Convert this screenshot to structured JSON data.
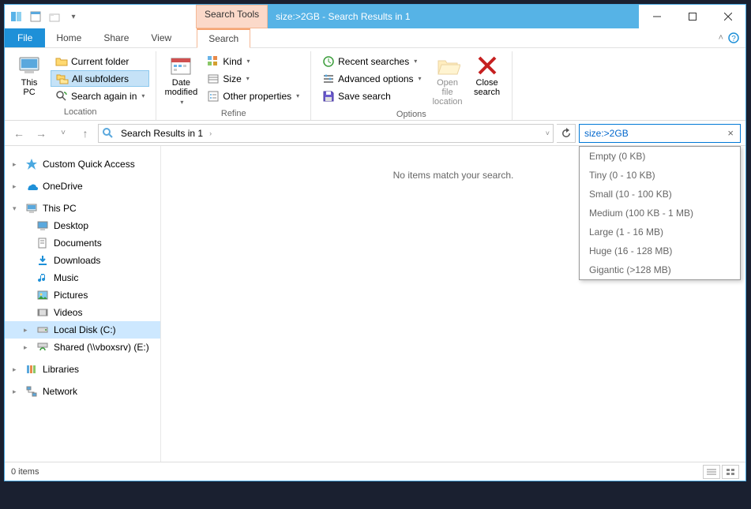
{
  "window": {
    "context_tab": "Search Tools",
    "title": "size:>2GB - Search Results in 1"
  },
  "menubar": {
    "file": "File",
    "tabs": [
      "Home",
      "Share",
      "View"
    ],
    "active_tab": "Search"
  },
  "ribbon": {
    "location": {
      "this_pc": "This\nPC",
      "current_folder": "Current folder",
      "all_subfolders": "All subfolders",
      "search_again": "Search again in",
      "group_label": "Location"
    },
    "refine": {
      "date_modified": "Date\nmodified",
      "kind": "Kind",
      "size": "Size",
      "other_props": "Other properties",
      "group_label": "Refine"
    },
    "options": {
      "recent": "Recent searches",
      "advanced": "Advanced options",
      "save": "Save search",
      "open_loc": "Open file\nlocation",
      "close": "Close\nsearch",
      "group_label": "Options"
    }
  },
  "nav": {
    "breadcrumb": "Search Results in 1",
    "search_value": "size:>2GB"
  },
  "tree": {
    "quick_access": "Custom Quick Access",
    "onedrive": "OneDrive",
    "this_pc": "This PC",
    "desktop": "Desktop",
    "documents": "Documents",
    "downloads": "Downloads",
    "music": "Music",
    "pictures": "Pictures",
    "videos": "Videos",
    "local_disk": "Local Disk (C:)",
    "shared": "Shared (\\\\vboxsrv) (E:)",
    "libraries": "Libraries",
    "network": "Network"
  },
  "content": {
    "empty_msg": "No items match your search."
  },
  "dropdown": {
    "items": [
      "Empty (0 KB)",
      "Tiny (0 - 10 KB)",
      "Small (10 - 100 KB)",
      "Medium (100 KB - 1 MB)",
      "Large (1 - 16 MB)",
      "Huge (16 - 128 MB)",
      "Gigantic (>128 MB)"
    ]
  },
  "status": {
    "items": "0 items"
  }
}
